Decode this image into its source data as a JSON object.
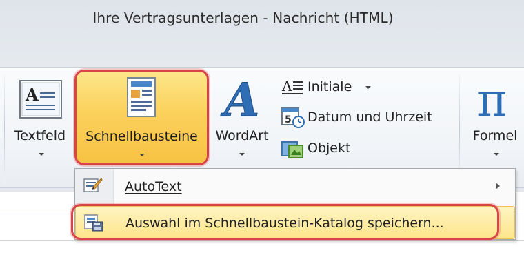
{
  "window": {
    "title": "Ihre Vertragsunterlagen  -  Nachricht (HTML)"
  },
  "ribbon": {
    "textbox_label": "Textfeld",
    "quickparts_label": "Schnellbausteine",
    "wordart_label": "WordArt",
    "dropcap_label": "Initiale",
    "datetime_label": "Datum und Uhrzeit",
    "object_label": "Objekt",
    "equation_label": "Formel"
  },
  "menu": {
    "autotext_label": "AutoText",
    "save_selection_label": "Auswahl im Schnellbaustein-Katalog speichern..."
  },
  "colors": {
    "highlight": "#f8c243",
    "annotation": "#d9434a"
  }
}
